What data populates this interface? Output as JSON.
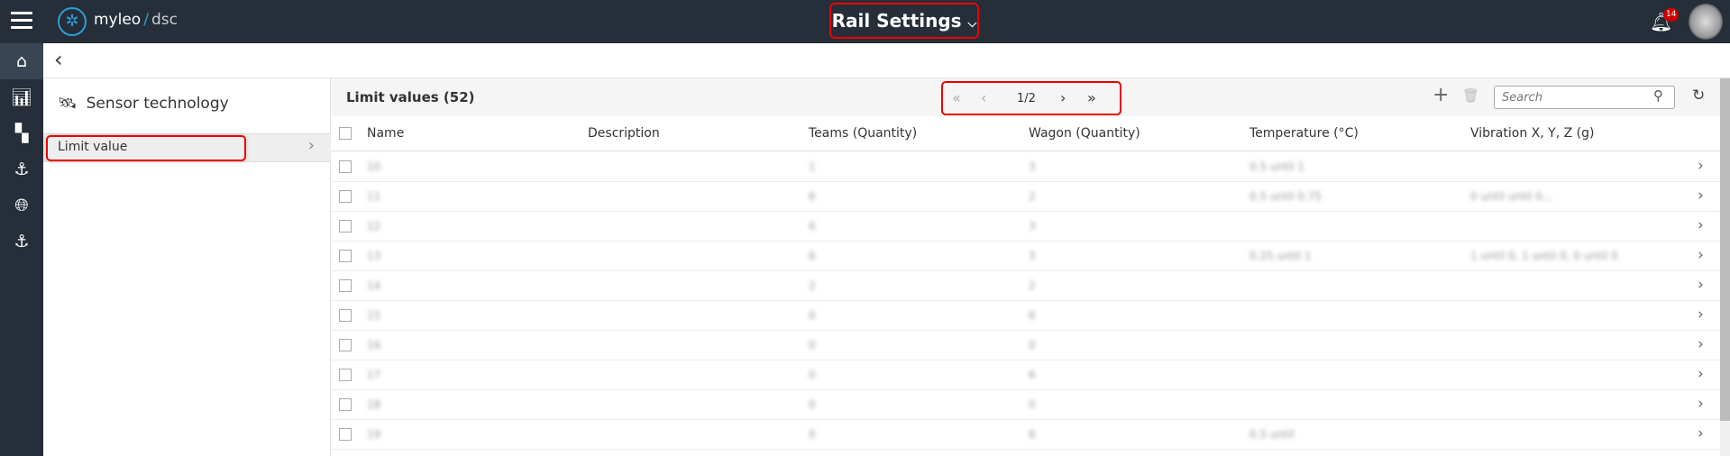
{
  "topbar": {
    "brand": "myleo",
    "brand_sep": "/",
    "brand_sub": "dsc",
    "title": "Rail Settings",
    "notifications": "14"
  },
  "leftpanel": {
    "section": "Sensor technology",
    "item": "Limit value"
  },
  "toolbar": {
    "title": "Limit values (52)",
    "page": "1/2",
    "search_placeholder": "Search"
  },
  "table": {
    "headers": [
      "Name",
      "Description",
      "Teams (Quantity)",
      "Wagon (Quantity)",
      "Temperature (°C)",
      "Vibration X, Y, Z (g)"
    ],
    "rows": [
      [
        "10",
        "",
        "1",
        "3",
        "0.5 until 1",
        ""
      ],
      [
        "11",
        "",
        "6",
        "2",
        "0.5 until 0.75",
        "0 until until 0..."
      ],
      [
        "12",
        "",
        "6",
        "3",
        "",
        ""
      ],
      [
        "13",
        "",
        "6",
        "3",
        "0.25 until 1",
        "1 until 0, 1 until 0, 0 until 0"
      ],
      [
        "14",
        "",
        "2",
        "2",
        "",
        ""
      ],
      [
        "15",
        "",
        "0",
        "6",
        "",
        ""
      ],
      [
        "16",
        "",
        "0",
        "0",
        "",
        ""
      ],
      [
        "17",
        "",
        "0",
        "6",
        "",
        ""
      ],
      [
        "18",
        "",
        "0",
        "0",
        "",
        ""
      ],
      [
        "19",
        "",
        "0",
        "6",
        "0.5 until",
        ""
      ]
    ]
  }
}
